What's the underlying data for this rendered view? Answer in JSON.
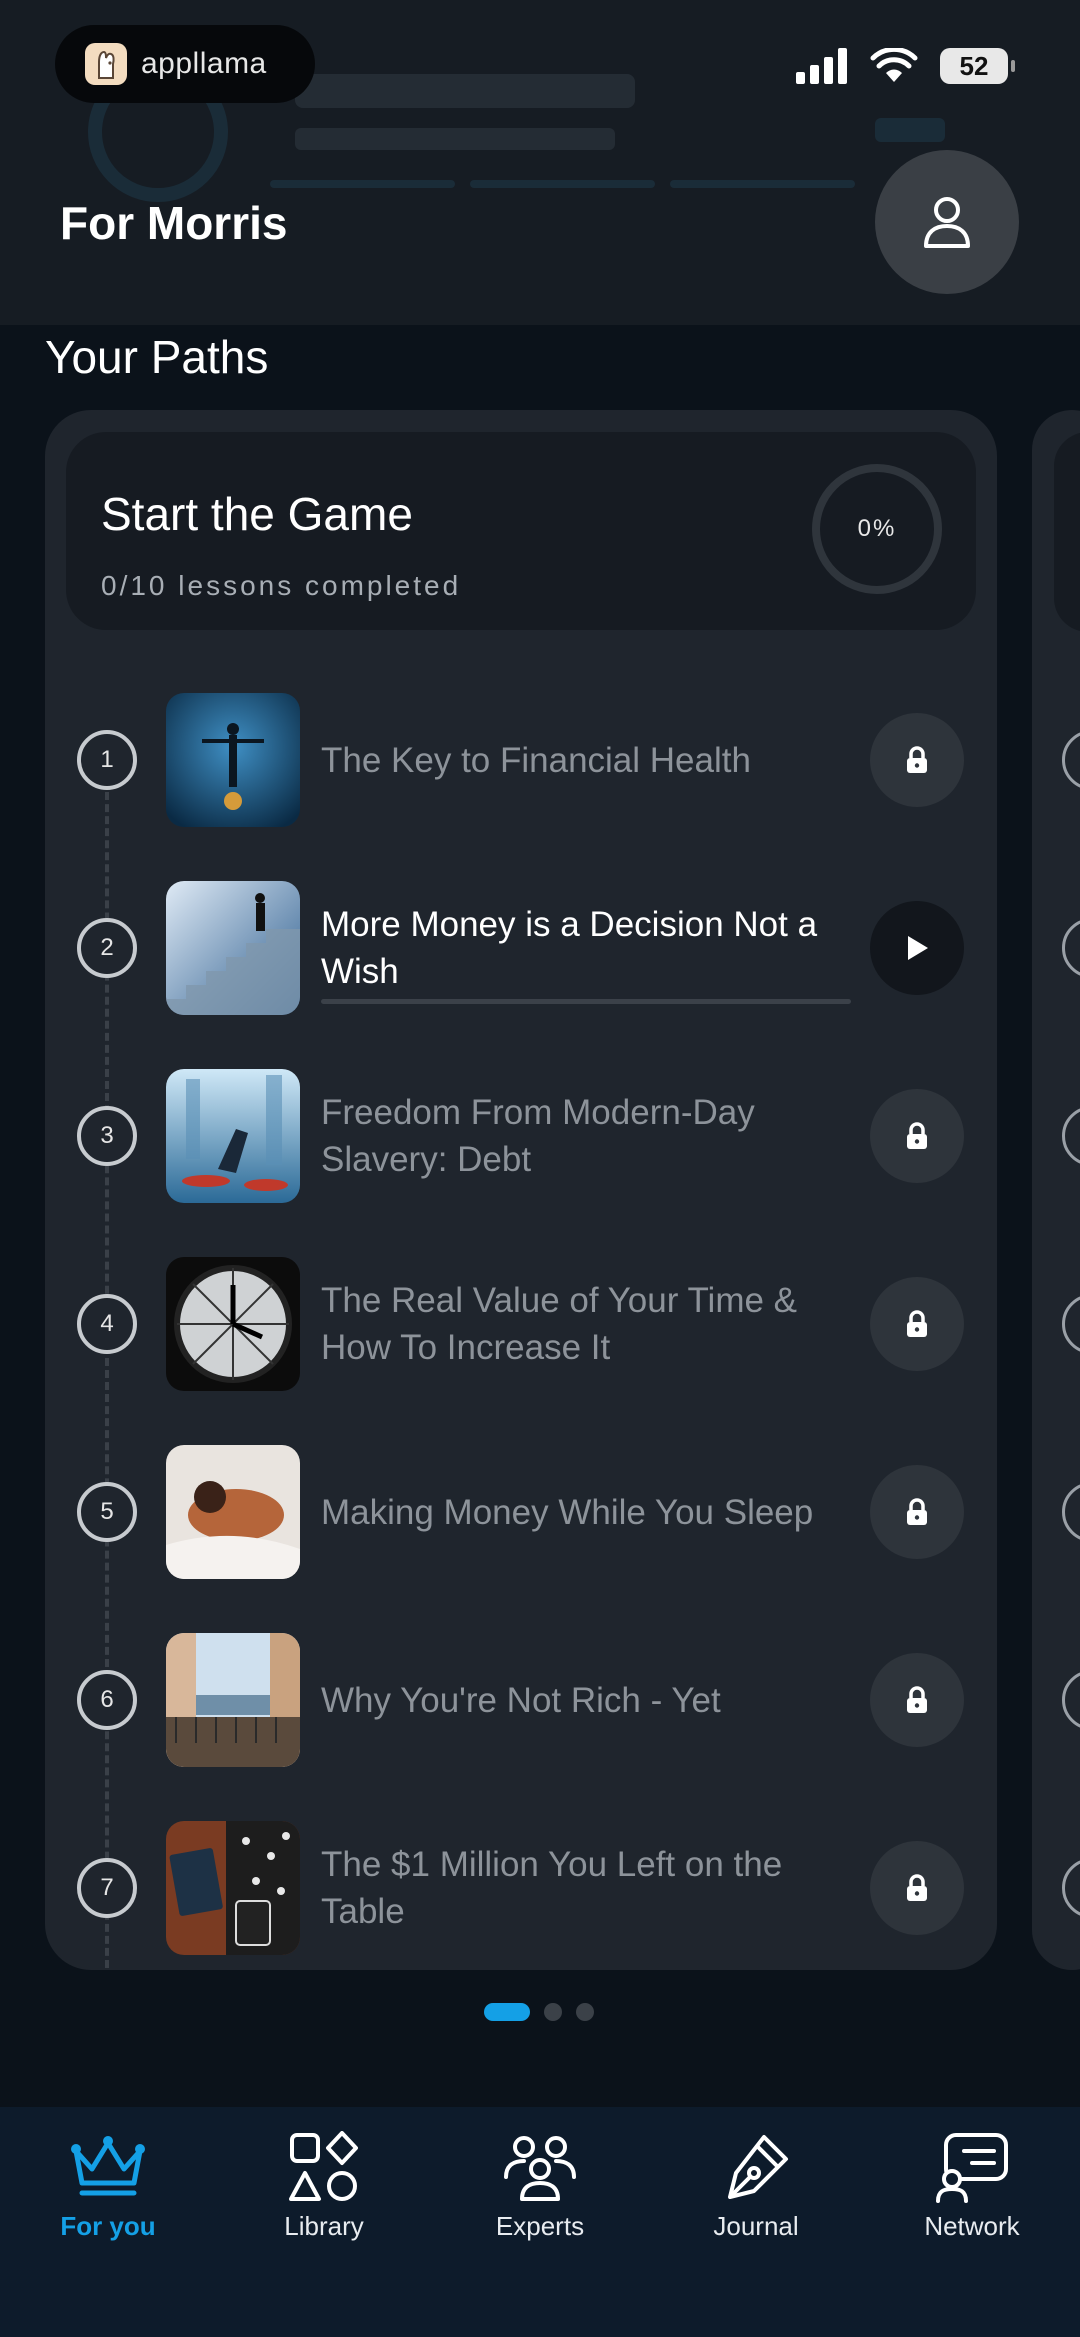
{
  "status_bar": {
    "app_name": "appllama",
    "battery": "52"
  },
  "header": {
    "title": "For Morris"
  },
  "section": {
    "title": "Your Paths"
  },
  "path": {
    "title": "Start the Game",
    "subtitle": "0/10 lessons completed",
    "progress_label": "0%",
    "progress": 0
  },
  "lessons": [
    {
      "number": "1",
      "title": "The Key to Financial Health",
      "state": "locked"
    },
    {
      "number": "2",
      "title": "More Money is a Decision Not a Wish",
      "state": "active"
    },
    {
      "number": "3",
      "title": "Freedom From Modern-Day Slavery: Debt",
      "state": "locked"
    },
    {
      "number": "4",
      "title": "The Real Value of Your Time & How To Increase It",
      "state": "locked"
    },
    {
      "number": "5",
      "title": "Making Money While You Sleep",
      "state": "locked"
    },
    {
      "number": "6",
      "title": "Why You're Not Rich - Yet",
      "state": "locked"
    },
    {
      "number": "7",
      "title": "The $1 Million You Left on the Table",
      "state": "locked"
    }
  ],
  "pager": {
    "count": 3,
    "active": 0
  },
  "nav": [
    {
      "label": "For you",
      "icon": "crown-icon",
      "active": true
    },
    {
      "label": "Library",
      "icon": "shapes-icon",
      "active": false
    },
    {
      "label": "Experts",
      "icon": "people-icon",
      "active": false
    },
    {
      "label": "Journal",
      "icon": "pen-icon",
      "active": false
    },
    {
      "label": "Network",
      "icon": "chat-icon",
      "active": false
    }
  ],
  "colors": {
    "accent": "#14a0e6",
    "card": "#1f252d",
    "background": "#0b121a"
  }
}
